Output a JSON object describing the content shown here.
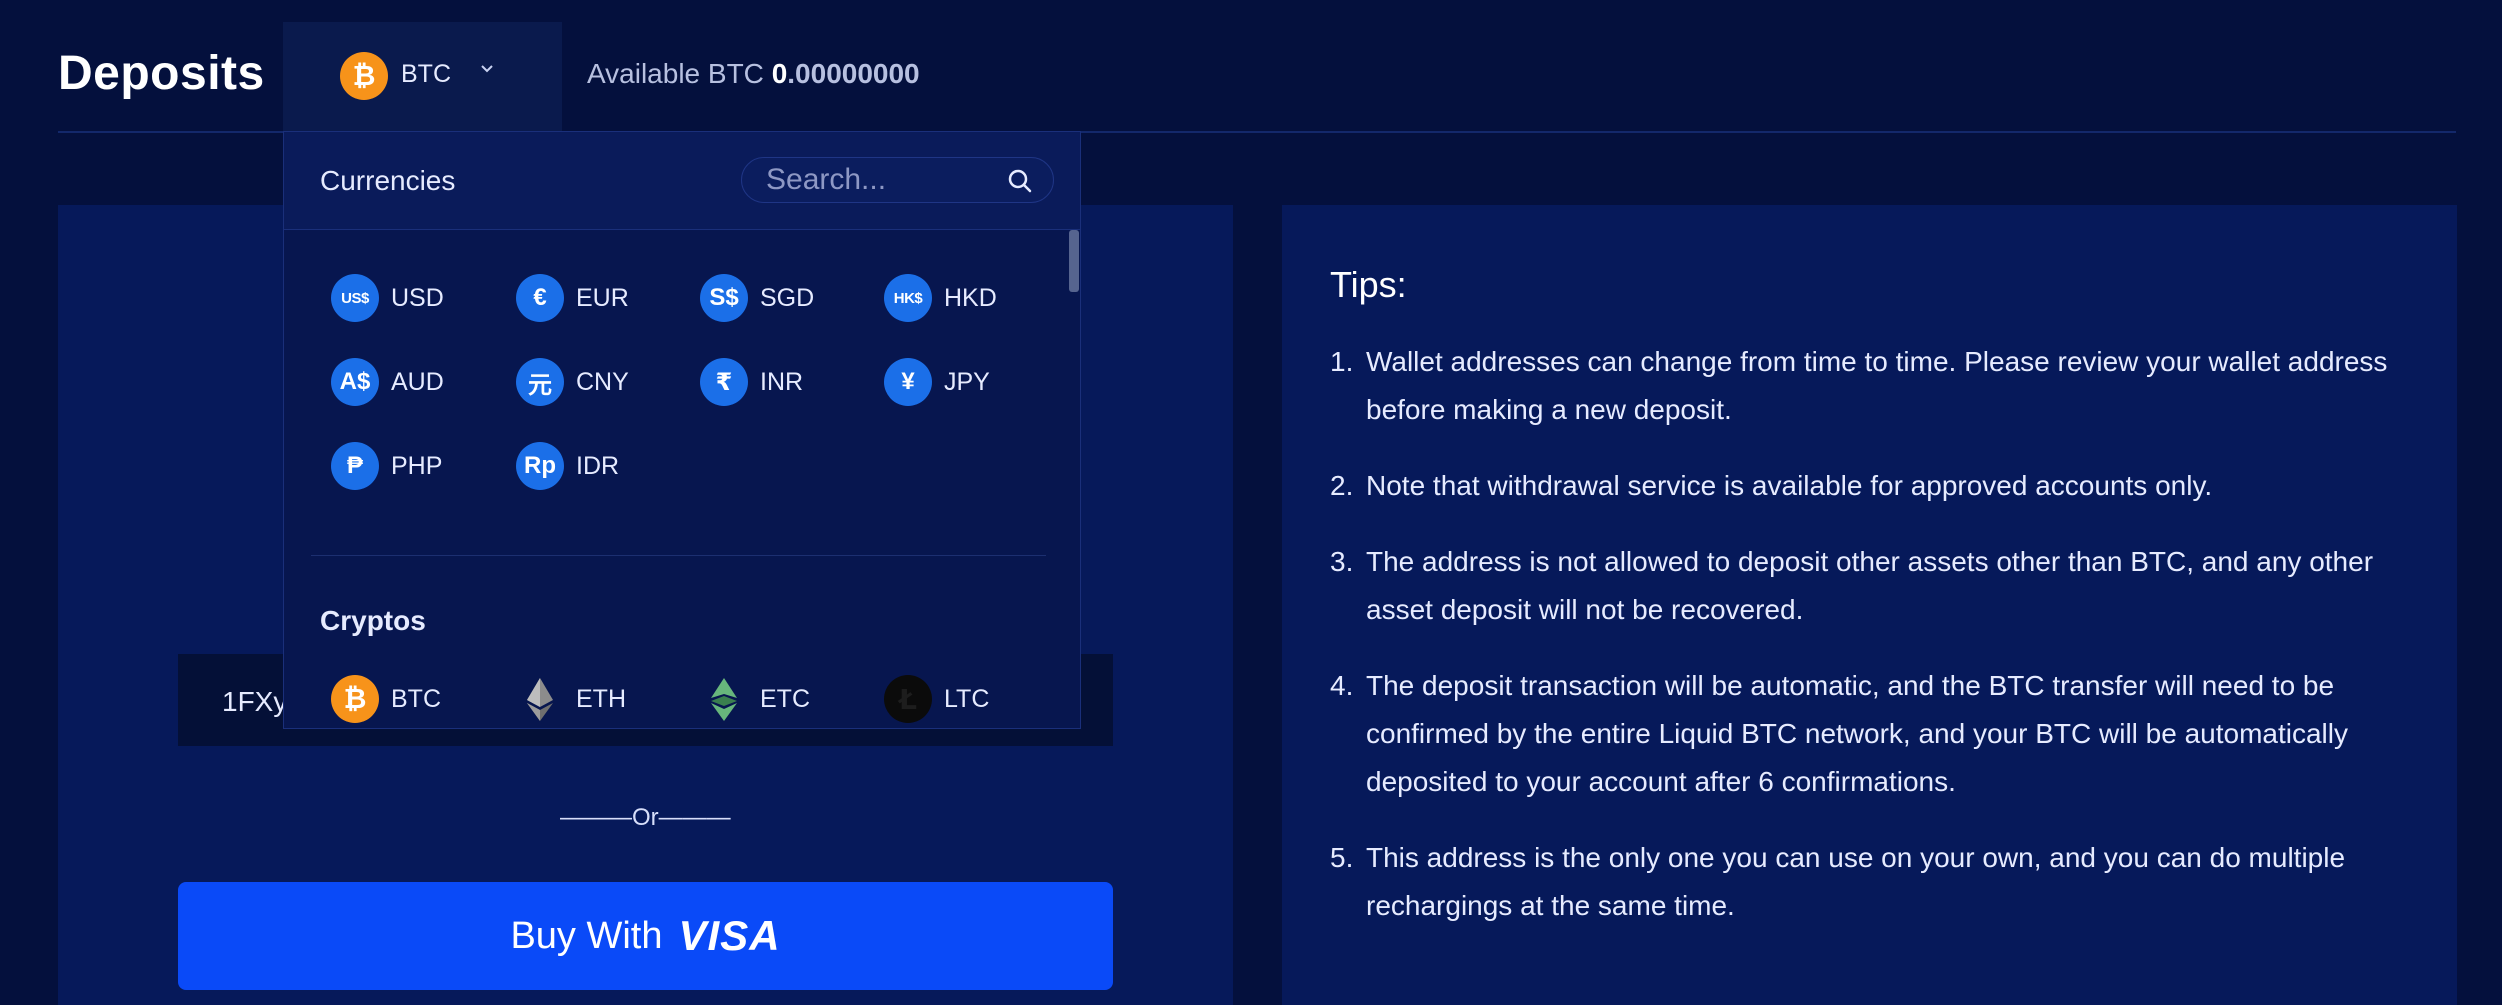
{
  "header": {
    "title": "Deposits",
    "selected_currency": "BTC",
    "available_label": "Available BTC",
    "available_whole": "0",
    "available_frac": ".00000000"
  },
  "dropdown": {
    "currencies_title": "Currencies",
    "search_placeholder": "Search...",
    "currencies": [
      {
        "code": "USD",
        "symbol": "US$"
      },
      {
        "code": "EUR",
        "symbol": "€"
      },
      {
        "code": "SGD",
        "symbol": "S$"
      },
      {
        "code": "HKD",
        "symbol": "HK$"
      },
      {
        "code": "AUD",
        "symbol": "A$"
      },
      {
        "code": "CNY",
        "symbol": "元"
      },
      {
        "code": "INR",
        "symbol": "₹"
      },
      {
        "code": "JPY",
        "symbol": "¥"
      },
      {
        "code": "PHP",
        "symbol": "₱"
      },
      {
        "code": "IDR",
        "symbol": "Rp"
      }
    ],
    "cryptos_title": "Cryptos",
    "cryptos": [
      {
        "code": "BTC",
        "icon": "bitcoin-icon"
      },
      {
        "code": "ETH",
        "icon": "ethereum-icon"
      },
      {
        "code": "ETC",
        "icon": "ethereum-classic-icon"
      },
      {
        "code": "LTC",
        "icon": "litecoin-icon"
      }
    ]
  },
  "deposit": {
    "address_partial": "1FXy",
    "or_text": "———Or———",
    "buy_label": "Buy With",
    "buy_brand": "VISA"
  },
  "tips": {
    "title": "Tips:",
    "items": [
      "Wallet addresses can change from time to time. Please review your wallet address before making a new deposit.",
      "Note that withdrawal service is available for approved accounts only.",
      "The address is not allowed to deposit other assets other than BTC, and any other asset deposit will not be recovered.",
      "The deposit transaction will be automatic, and the BTC transfer will need to be confirmed by the entire Liquid BTC network, and your BTC will be automatically deposited to your account after 6 confirmations.",
      "This address is the only one you can use on your own, and you can do multiple rechargings at the same time."
    ]
  },
  "colors": {
    "background": "#04103d",
    "panel": "#06195a",
    "accent_button": "#0a4af8",
    "currency_icon": "#1b6fe8",
    "bitcoin": "#f7931a"
  }
}
